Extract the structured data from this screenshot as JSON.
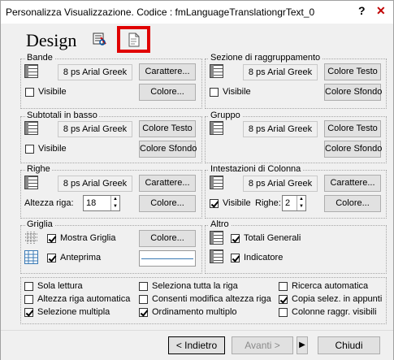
{
  "window": {
    "title": "Personalizza Visualizzazione. Codice : fmLanguageTranslationgrText_0",
    "help_glyph": "?",
    "close_glyph": "✕"
  },
  "header": {
    "title": "Design"
  },
  "groups": {
    "bande": {
      "title": "Bande",
      "font": "8 ps Arial Greek",
      "font_button": "Carattere...",
      "visibile": "Visibile",
      "visibile_checked": false,
      "color_button": "Colore..."
    },
    "sezione": {
      "title": "Sezione di raggruppamento",
      "font": "8 ps Arial Greek",
      "text_color_button": "Colore Testo",
      "visibile": "Visibile",
      "visibile_checked": false,
      "bg_color_button": "Colore Sfondo"
    },
    "subtotali": {
      "title": "Subtotali in basso",
      "font": "8 ps Arial Greek",
      "text_color_button": "Colore Testo",
      "visibile": "Visibile",
      "visibile_checked": false,
      "bg_color_button": "Colore Sfondo"
    },
    "gruppo": {
      "title": "Gruppo",
      "font": "8 ps Arial Greek",
      "text_color_button": "Colore Testo",
      "bg_color_button": "Colore Sfondo"
    },
    "righe": {
      "title": "Righe",
      "font": "8 ps Arial Greek",
      "font_button": "Carattere...",
      "altezza_label": "Altezza riga:",
      "altezza_value": "18",
      "color_button": "Colore..."
    },
    "intestazioni": {
      "title": "Intestazioni di Colonna",
      "font": "8 ps Arial Greek",
      "font_button": "Carattere...",
      "visibile": "Visibile",
      "visibile_checked": true,
      "righe_label": "Righe:",
      "righe_value": "2",
      "color_button": "Colore..."
    },
    "griglia": {
      "title": "Griglia",
      "mostra": "Mostra Griglia",
      "mostra_checked": true,
      "color_button": "Colore...",
      "anteprima": "Anteprima",
      "anteprima_checked": true
    },
    "altro": {
      "title": "Altro",
      "totali": "Totali Generali",
      "totali_checked": true,
      "indicatore": "Indicatore",
      "indicatore_checked": true
    }
  },
  "options": [
    {
      "label": "Sola lettura",
      "checked": false
    },
    {
      "label": "Seleziona tutta la riga",
      "checked": false
    },
    {
      "label": "Ricerca automatica",
      "checked": false
    },
    {
      "label": "Altezza riga automatica",
      "checked": false
    },
    {
      "label": "Consenti modifica altezza riga",
      "checked": false
    },
    {
      "label": "Copia selez. in appunti",
      "checked": true
    },
    {
      "label": "Selezione multipla",
      "checked": true
    },
    {
      "label": "Ordinamento multiplo",
      "checked": true
    },
    {
      "label": "Colonne raggr. visibili",
      "checked": false
    }
  ],
  "footer": {
    "back_label": "< Indietro",
    "next_label": "Avanti >",
    "close_label": "Chiudi",
    "more_glyph": "▶"
  },
  "colors": {
    "highlight": "#e00000"
  }
}
